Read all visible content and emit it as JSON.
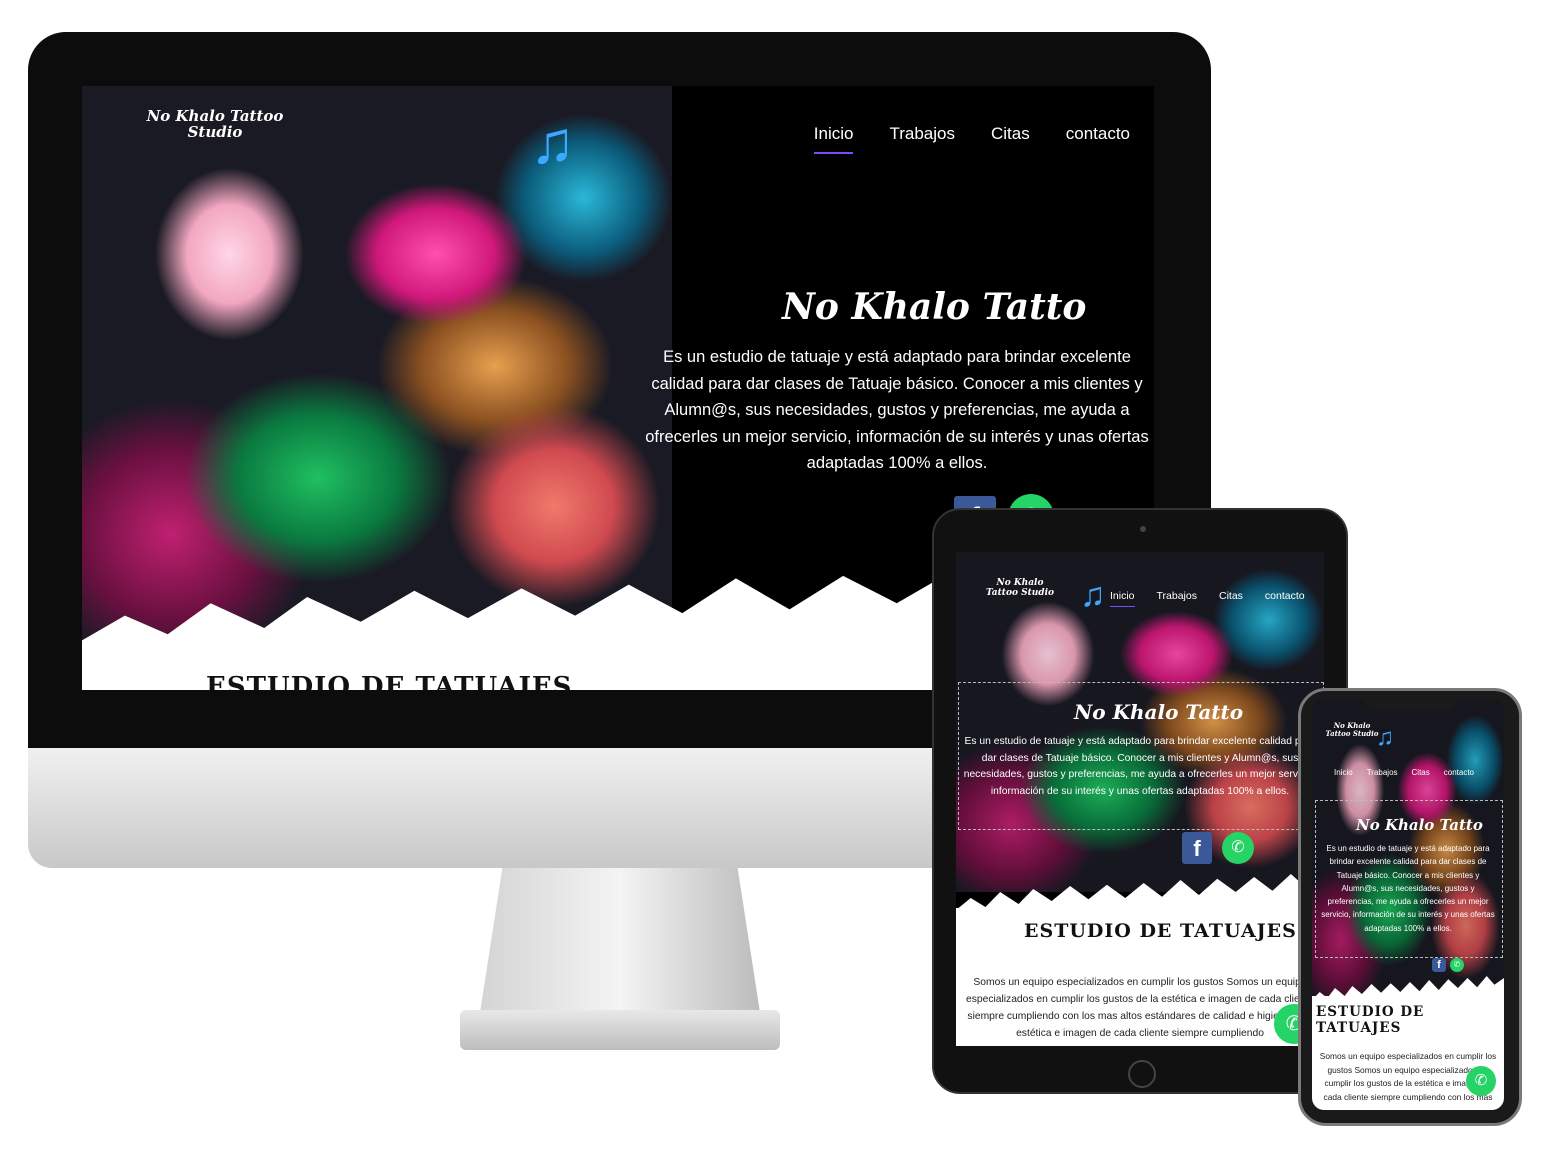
{
  "brand": "No Khalo Tatto",
  "logo_text": "No Khalo Tattoo Studio",
  "nav": [
    "Inicio",
    "Trabajos",
    "Citas",
    "contacto"
  ],
  "hero_description": "Es un estudio de tatuaje y está adaptado para brindar excelente calidad para dar clases de Tatuaje básico. Conocer a mis clientes y Alumn@s, sus necesidades, gustos y preferencias, me ayuda a ofrecerles un mejor servicio, información de su interés y unas ofertas adaptadas 100% a ellos.",
  "section_heading": "ESTUDIO DE TATUAJES",
  "section_text_tablet": "Somos un equipo especializados en cumplir los gustos Somos un equipo especializados en cumplir los gustos de la estética e imagen de cada cliente siempre cumpliendo con los mas altos estándares de calidad e higienede la estética e imagen de cada cliente siempre cumpliendo",
  "section_text_phone": "Somos un equipo especializados en cumplir los gustos Somos un equipo especializados en cumplir los gustos de la estética e imagen de cada cliente siempre cumpliendo con los mas",
  "icons": {
    "facebook": "facebook-icon",
    "whatsapp": "whatsapp-icon",
    "music": "music-note-icon"
  },
  "colors": {
    "background": "#000000",
    "accent_underline": "#7a4cff",
    "facebook": "#3b5998",
    "whatsapp": "#25d366",
    "note": "#3aa9ff"
  }
}
